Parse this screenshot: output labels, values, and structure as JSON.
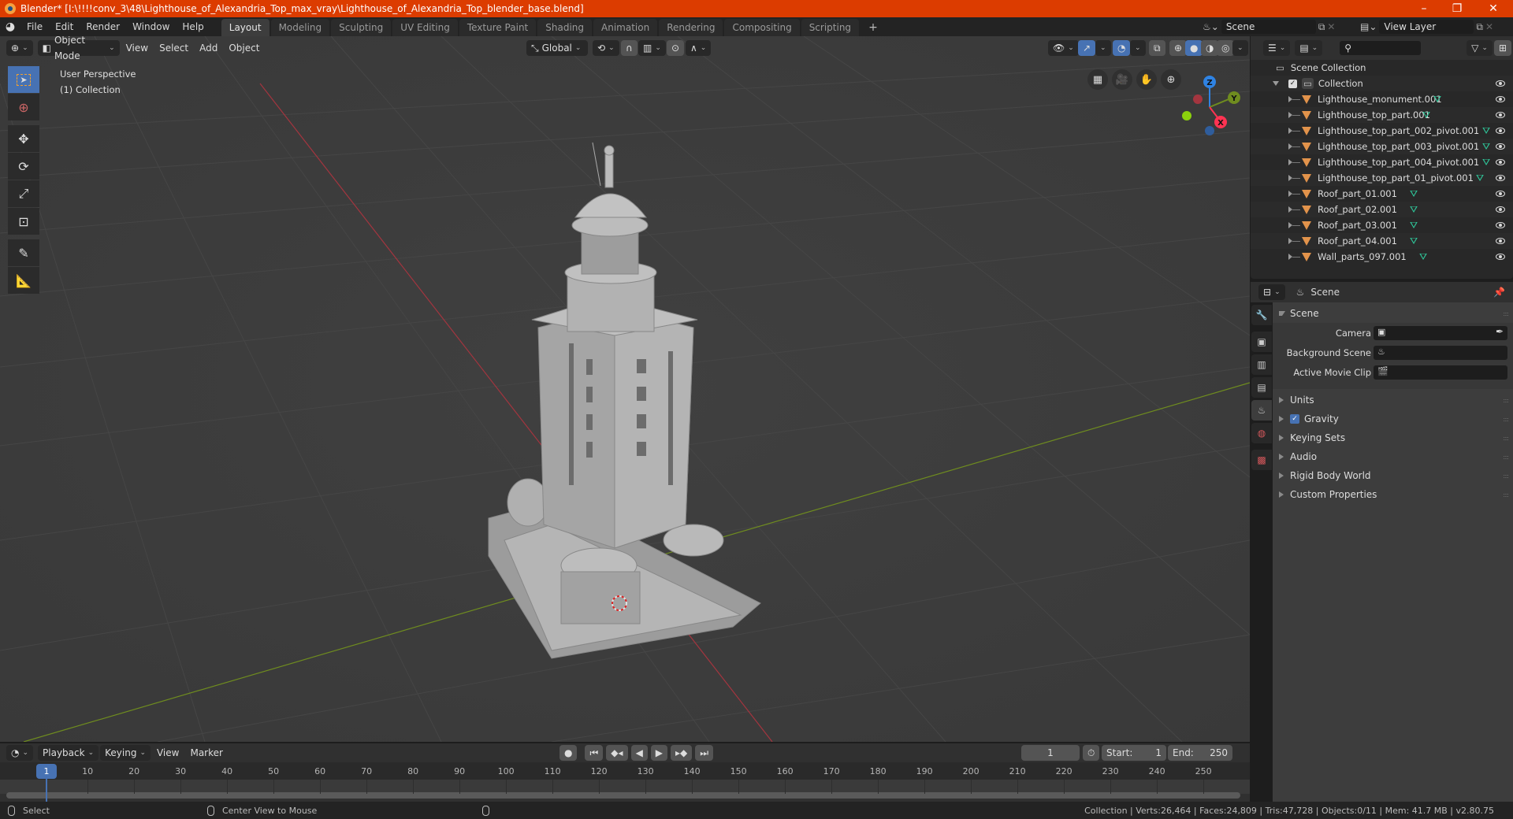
{
  "titlebar": {
    "title": "Blender* [I:\\!!!!conv_3\\48\\Lighthouse_of_Alexandria_Top_max_vray\\Lighthouse_of_Alexandria_Top_blender_base.blend]",
    "minimize": "–",
    "maximize": "❐",
    "close": "✕"
  },
  "menu": {
    "items": [
      "File",
      "Edit",
      "Render",
      "Window",
      "Help"
    ]
  },
  "workspaces": {
    "tabs": [
      "Layout",
      "Modeling",
      "Sculpting",
      "UV Editing",
      "Texture Paint",
      "Shading",
      "Animation",
      "Rendering",
      "Compositing",
      "Scripting"
    ],
    "active": "Layout",
    "add": "+"
  },
  "scene_selector": {
    "value": "Scene"
  },
  "viewlayer_selector": {
    "value": "View Layer"
  },
  "viewport_header": {
    "mode": "Object Mode",
    "menus": [
      "View",
      "Select",
      "Add",
      "Object"
    ],
    "orientation": "Global"
  },
  "viewport": {
    "view_name": "User Perspective",
    "collection_label": "(1) Collection",
    "gizmo": {
      "x": "X",
      "y": "Y",
      "z": "Z"
    },
    "colors": {
      "x_axis": "#a3353f",
      "y_axis": "#6f8c1f",
      "x_gizmo": "#ff3352",
      "y_gizmo": "#8bb827",
      "z_gizmo": "#2f83e3"
    }
  },
  "outliner": {
    "search_placeholder": "",
    "scene_collection": "Scene Collection",
    "collection": "Collection",
    "objects": [
      "Lighthouse_monument.001",
      "Lighthouse_top_part.001",
      "Lighthouse_top_part_002_pivot.001",
      "Lighthouse_top_part_003_pivot.001",
      "Lighthouse_top_part_004_pivot.001",
      "Lighthouse_top_part_01_pivot.001",
      "Roof_part_01.001",
      "Roof_part_02.001",
      "Roof_part_03.001",
      "Roof_part_04.001",
      "Wall_parts_097.001"
    ]
  },
  "properties": {
    "context": "Scene",
    "panel_scene": {
      "title": "Scene",
      "camera_label": "Camera",
      "background_scene_label": "Background Scene",
      "active_movie_clip_label": "Active Movie Clip"
    },
    "panels": [
      "Units",
      "Gravity",
      "Keying Sets",
      "Audio",
      "Rigid Body World",
      "Custom Properties"
    ],
    "gravity_checked": true
  },
  "timeline": {
    "menus": [
      "Playback",
      "Keying",
      "View",
      "Marker"
    ],
    "current_frame": "1",
    "start_label": "Start:",
    "start": "1",
    "end_label": "End:",
    "end": "250",
    "ticks": [
      "10",
      "20",
      "30",
      "40",
      "50",
      "60",
      "70",
      "80",
      "90",
      "100",
      "110",
      "120",
      "130",
      "140",
      "150",
      "160",
      "170",
      "180",
      "190",
      "200",
      "210",
      "220",
      "230",
      "240",
      "250"
    ],
    "playhead": "1"
  },
  "statusbar": {
    "select": "Select",
    "center_view": "Center View to Mouse",
    "stats": "Collection | Verts:26,464 | Faces:24,809 | Tris:47,728 | Objects:0/11 | Mem: 41.7 MB | v2.80.75"
  }
}
